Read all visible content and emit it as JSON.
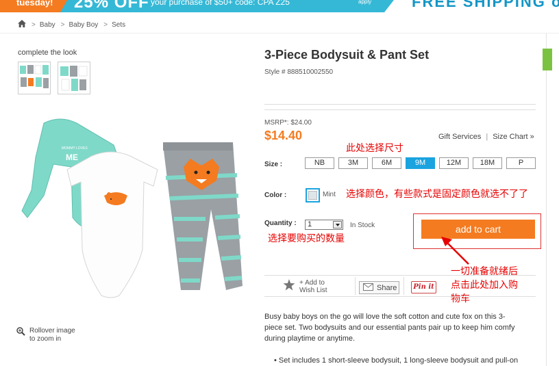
{
  "promo": {
    "left_text": "tuesday!",
    "off_text": "25% OFF",
    "mid_text": "your purchase of $50+ code: CPA Z25",
    "apply_text": "apply",
    "shipping_text": "FREE SHIPPING on your"
  },
  "breadcrumb": {
    "items": [
      "Baby",
      "Baby Boy",
      "Sets"
    ]
  },
  "left": {
    "complete_the_look": "complete the look",
    "zoom_line1": "Rollover image",
    "zoom_line2": "to zoom in"
  },
  "product": {
    "title": "3-Piece Bodysuit & Pant Set",
    "style": "Style # 888510002550",
    "msrp": "MSRP*: $24.00",
    "price": "$14.40",
    "gift_services": "Gift Services",
    "size_chart": "Size Chart »",
    "size_label": "Size :",
    "sizes": [
      "NB",
      "3M",
      "6M",
      "9M",
      "12M",
      "18M",
      "P"
    ],
    "selected_size": "9M",
    "color_label": "Color :",
    "color_name": "Mint",
    "quantity_label": "Quantity :",
    "quantity_value": "1",
    "stock": "In Stock",
    "add_to_cart": "add to cart",
    "wish_line1": "+ Add to",
    "wish_line2": "Wish List",
    "share": "Share",
    "pin_it": "Pin it",
    "description": "Busy baby boys on the go will love the soft cotton and cute fox on this 3-piece set. Two bodysuits and our essential pants pair up to keep him comfy during playtime or anytime.",
    "bullet": "• Set includes 1 short-sleeve bodysuit, 1 long-sleeve bodysuit and pull-on"
  },
  "annotations": {
    "size_note": "此处选择尺寸",
    "color_note": "选择颜色，有些款式是固定颜色就选不了了",
    "qty_note": "选择要购买的数量",
    "cart_note_line1": "一切准备就绪后",
    "cart_note_line2": "点击此处加入购",
    "cart_note_line3": "物车"
  },
  "colors": {
    "accent_orange": "#f47b20",
    "selected_blue": "#1aa3df",
    "note_red": "#e60000",
    "promo_blue": "#35b8d6",
    "mint": "#7fd9c9"
  }
}
